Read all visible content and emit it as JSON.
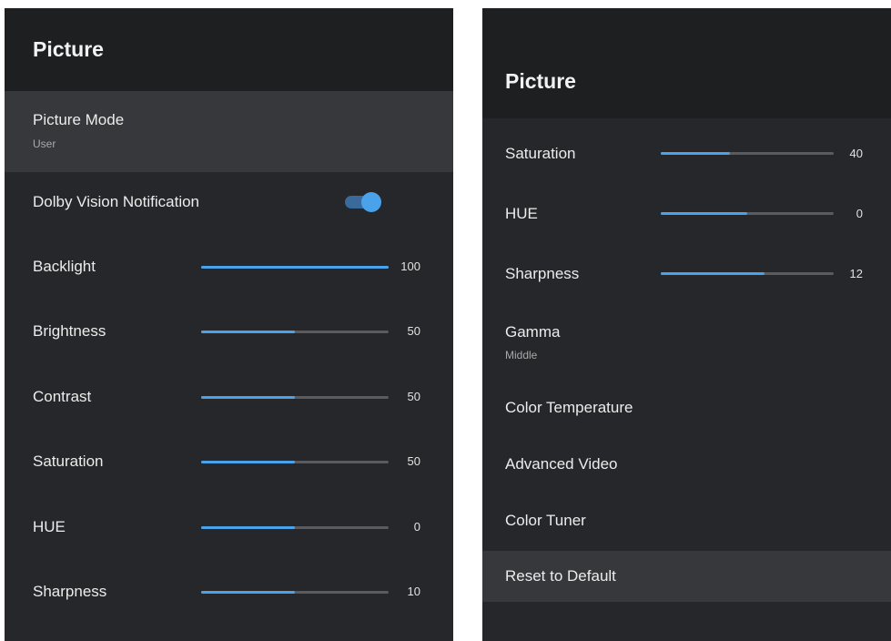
{
  "colors": {
    "background": "#26272a",
    "header": "#1e1f21",
    "focus_row": "#37383b",
    "accent": "#4aa3ea",
    "track": "#5a5b5e"
  },
  "left_panel": {
    "title": "Picture",
    "picture_mode": {
      "label": "Picture Mode",
      "value": "User"
    },
    "dolby_vision": {
      "label": "Dolby Vision Notification",
      "on": true
    },
    "sliders": [
      {
        "label": "Backlight",
        "value": "100",
        "fraction": 1.0
      },
      {
        "label": "Brightness",
        "value": "50",
        "fraction": 0.5
      },
      {
        "label": "Contrast",
        "value": "50",
        "fraction": 0.5
      },
      {
        "label": "Saturation",
        "value": "50",
        "fraction": 0.5
      },
      {
        "label": "HUE",
        "value": "0",
        "fraction": 0.5
      },
      {
        "label": "Sharpness",
        "value": "10",
        "fraction": 0.5
      }
    ]
  },
  "right_panel": {
    "title": "Picture",
    "sliders": [
      {
        "label": "Saturation",
        "value": "40",
        "fraction": 0.4
      },
      {
        "label": "HUE",
        "value": "0",
        "fraction": 0.5
      },
      {
        "label": "Sharpness",
        "value": "12",
        "fraction": 0.6
      }
    ],
    "gamma": {
      "label": "Gamma",
      "value": "Middle"
    },
    "items": [
      {
        "label": "Color Temperature"
      },
      {
        "label": "Advanced Video"
      },
      {
        "label": "Color Tuner"
      },
      {
        "label": "Reset to Default"
      }
    ]
  }
}
